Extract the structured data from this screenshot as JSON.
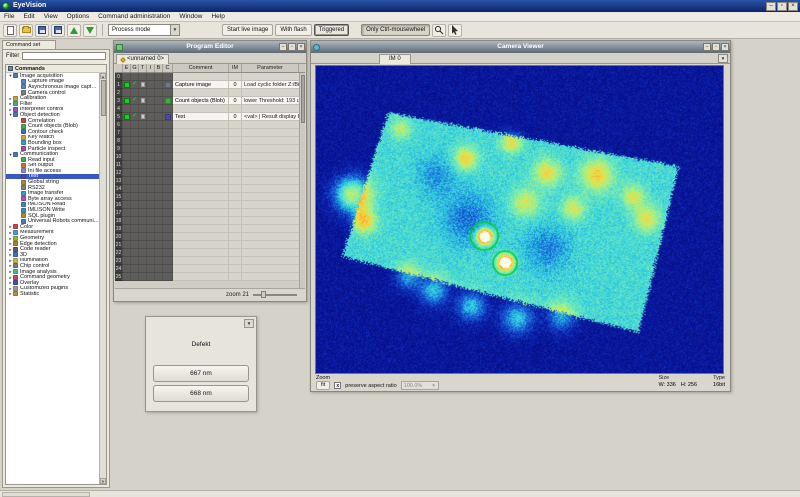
{
  "app": {
    "title": "EyeVision"
  },
  "win": {
    "minimize": "–",
    "maximize": "▫",
    "close": "×"
  },
  "menubar": {
    "items": [
      "File",
      "Edit",
      "View",
      "Options",
      "Command administration",
      "Window",
      "Help"
    ]
  },
  "toolbar": {
    "process_mode": "Process mode",
    "start_live": "Start live image",
    "with_flash": "With flash",
    "triggered": "Triggered",
    "ctrl_wheel": "Only Ctrl-mousewheel"
  },
  "sidebar": {
    "tab": "Command set",
    "filter_label": "Filter",
    "filter_value": "",
    "commands_header": "Commands",
    "tree": [
      {
        "label": "Image acquisition",
        "depth": 0,
        "parent": true,
        "expanded": true,
        "color": "#4a78b8"
      },
      {
        "label": "Capture image",
        "depth": 1,
        "color": "#5a82c0"
      },
      {
        "label": "Asynchronous image capture",
        "depth": 1,
        "color": "#5a82c0"
      },
      {
        "label": "Camera control",
        "depth": 1,
        "color": "#7d7d7d"
      },
      {
        "label": "Calibration",
        "depth": 0,
        "parent": true,
        "color": "#b8a24a"
      },
      {
        "label": "Filter",
        "depth": 0,
        "parent": true,
        "color": "#3fae8a"
      },
      {
        "label": "Interpreter control",
        "depth": 0,
        "parent": true,
        "color": "#8a5ab8"
      },
      {
        "label": "Object detection",
        "depth": 0,
        "parent": true,
        "expanded": true,
        "color": "#4a78b8"
      },
      {
        "label": "Correlation",
        "depth": 1,
        "color": "#b84a4a"
      },
      {
        "label": "Count objects (Blob)",
        "depth": 1,
        "color": "#3fae3f"
      },
      {
        "label": "Contour check",
        "depth": 1,
        "color": "#4a6ab8"
      },
      {
        "label": "Key Match",
        "depth": 1,
        "color": "#c9a52f"
      },
      {
        "label": "Bounding box",
        "depth": 1,
        "color": "#2f9ec9"
      },
      {
        "label": "Particle inspect",
        "depth": 1,
        "color": "#a44ab8"
      },
      {
        "label": "Communication",
        "depth": 0,
        "parent": true,
        "expanded": true,
        "color": "#4a78b8"
      },
      {
        "label": "Read input",
        "depth": 1,
        "color": "#3fae3f"
      },
      {
        "label": "Set output",
        "depth": 1,
        "color": "#c9742f"
      },
      {
        "label": "Ini file access",
        "depth": 1,
        "color": "#8a8ac9"
      },
      {
        "label": "Text",
        "depth": 1,
        "selected": true,
        "color": "#4a4aa8"
      },
      {
        "label": "Global string",
        "depth": 1,
        "color": "#a8883f"
      },
      {
        "label": "RS232",
        "depth": 1,
        "color": "#808080"
      },
      {
        "label": "Image transfer",
        "depth": 1,
        "color": "#2f9ec9"
      },
      {
        "label": "Byte array access",
        "depth": 1,
        "color": "#b84ab8"
      },
      {
        "label": "IMLISON Read",
        "depth": 1,
        "color": "#3f8aae"
      },
      {
        "label": "IMLISON Write",
        "depth": 1,
        "color": "#3f8aae"
      },
      {
        "label": "SQL plugin",
        "depth": 1,
        "color": "#b8862f"
      },
      {
        "label": "Universal Robots communi...",
        "depth": 1,
        "color": "#4a78b8"
      },
      {
        "label": "Color",
        "depth": 0,
        "parent": true,
        "color": "#c94a4a"
      },
      {
        "label": "Measurement",
        "depth": 0,
        "parent": true,
        "color": "#4a9ec9"
      },
      {
        "label": "Geometry",
        "depth": 0,
        "parent": true,
        "color": "#8ab83f"
      },
      {
        "label": "Edge detection",
        "depth": 0,
        "parent": true,
        "color": "#b8743f"
      },
      {
        "label": "Code reader",
        "depth": 0,
        "parent": true,
        "color": "#5d5d5d"
      },
      {
        "label": "3D",
        "depth": 0,
        "parent": true,
        "color": "#3f74b8"
      },
      {
        "label": "Illumination",
        "depth": 0,
        "parent": true,
        "color": "#c9b83f"
      },
      {
        "label": "Chip control",
        "depth": 0,
        "parent": true,
        "color": "#7d7d7d"
      },
      {
        "label": "Image analysis",
        "depth": 0,
        "parent": true,
        "color": "#4ab88a"
      },
      {
        "label": "Command geometry",
        "depth": 0,
        "parent": true,
        "color": "#b84a74"
      },
      {
        "label": "Overlay",
        "depth": 0,
        "parent": true,
        "color": "#4a4ab8"
      },
      {
        "label": "Customized plugins",
        "depth": 0,
        "parent": true,
        "color": "#999999"
      },
      {
        "label": "Statistic",
        "depth": 0,
        "parent": true,
        "color": "#b88a3f"
      }
    ]
  },
  "program_editor": {
    "title": "Program Editor",
    "tab": "<unnamed 0>",
    "columns": [
      "",
      "E",
      "G",
      "T",
      "I",
      "B",
      "C",
      "Comment",
      "IM",
      "Parameter"
    ],
    "row_count": 26,
    "commands": [
      {
        "row": 1,
        "comment": "Capture image",
        "im": "0",
        "param": "Load cyclic folder Z:/Bil...",
        "icon_color": "#6a7b8c",
        "icon_name": "capture-image-icon"
      },
      {
        "row": 3,
        "comment": "Count objects (Blob)",
        "im": "0",
        "param": "lower Threshold: 193 up...",
        "icon_color": "#3fae3f",
        "icon_name": "count-objects-icon"
      },
      {
        "row": 5,
        "comment": "Text",
        "im": "0",
        "param": "<val> | Result display R...",
        "icon_color": "#4a4aa8",
        "icon_name": "text-command-icon"
      }
    ],
    "zoom_label": "zoom 21"
  },
  "defekt_panel": {
    "title": "Defekt",
    "btn1": "667 nm",
    "btn2": "668 nm"
  },
  "camera_viewer": {
    "title": "Camera Viewer",
    "tab": "IM 0",
    "zoom_section": "Zoom",
    "fit": "fit",
    "preserve": "preserve aspect ratio",
    "zoom_value": "100.0%",
    "size_label": "Size",
    "size_w": "W: 336",
    "size_h": "H: 256",
    "type_label": "Type",
    "type_value": "16bit"
  }
}
